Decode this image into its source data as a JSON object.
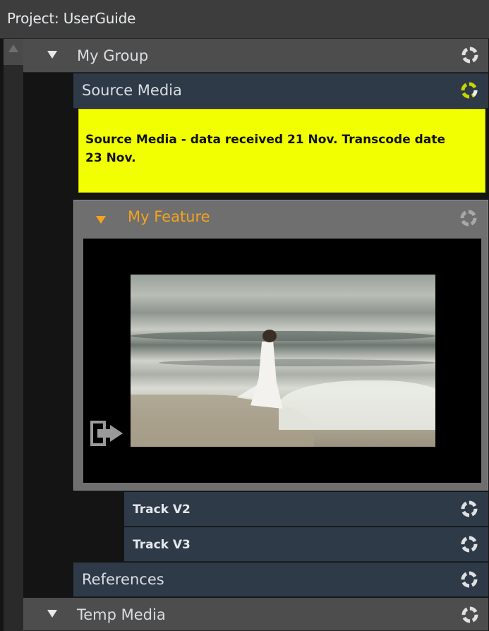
{
  "header": {
    "title": "Project: UserGuide"
  },
  "tree": {
    "my_group": {
      "label": "My Group"
    },
    "source_media": {
      "label": "Source Media"
    },
    "note": {
      "text": "Source Media - data received 21 Nov. Transcode date 23 Nov."
    },
    "my_feature": {
      "label": "My Feature"
    },
    "tracks": [
      {
        "label": "Track V2"
      },
      {
        "label": "Track V3"
      }
    ],
    "references": {
      "label": "References"
    },
    "temp_media": {
      "label": "Temp Media"
    }
  },
  "colors": {
    "header_bg": "#3d3d3d",
    "group_bg": "#4d4d4d",
    "item_bg": "#2e3a48",
    "note_bg": "#f2ff00",
    "feature_accent": "#f5a31e",
    "sync_active": "#c6d600"
  },
  "icons": {
    "sync": "sync-status-icon",
    "sync_active": "sync-active-icon",
    "export": "export-icon",
    "expand": "triangle-down-icon"
  }
}
